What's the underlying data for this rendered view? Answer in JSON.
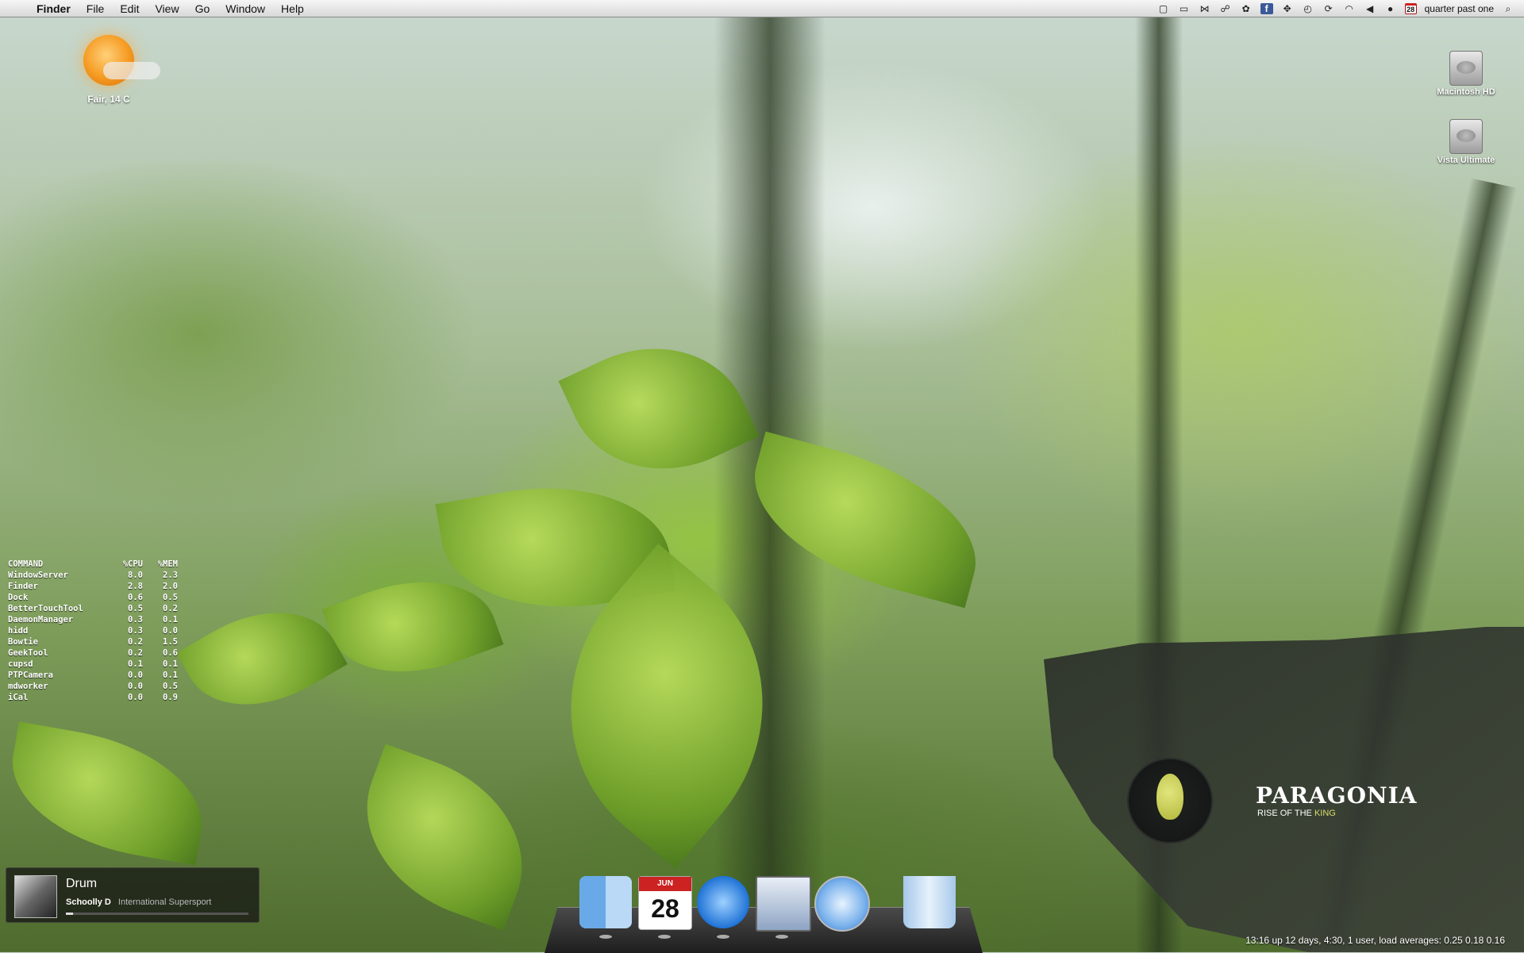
{
  "menubar": {
    "app_name": "Finder",
    "menus": [
      "File",
      "Edit",
      "View",
      "Go",
      "Window",
      "Help"
    ],
    "calendar_day": "28",
    "clock_text": "quarter past one"
  },
  "weather": {
    "text": "Fair, 14 C",
    "icon": "sun-icon"
  },
  "desktop_icons": [
    {
      "label": "Macintosh HD",
      "icon": "hard-drive-icon"
    },
    {
      "label": "Vista Ultimate",
      "icon": "hard-drive-icon"
    }
  ],
  "process_table": {
    "headers": [
      "COMMAND",
      "%CPU",
      "%MEM"
    ],
    "rows": [
      [
        "WindowServer",
        "8.0",
        "2.3"
      ],
      [
        "Finder",
        "2.8",
        "2.0"
      ],
      [
        "Dock",
        "0.6",
        "0.5"
      ],
      [
        "BetterTouchTool",
        "0.5",
        "0.2"
      ],
      [
        "DaemonManager",
        "0.3",
        "0.1"
      ],
      [
        "hidd",
        "0.3",
        "0.0"
      ],
      [
        "Bowtie",
        "0.2",
        "1.5"
      ],
      [
        "GeekTool",
        "0.2",
        "0.6"
      ],
      [
        "cupsd",
        "0.1",
        "0.1"
      ],
      [
        "PTPCamera",
        "0.0",
        "0.1"
      ],
      [
        "mdworker",
        "0.0",
        "0.5"
      ],
      [
        "iCal",
        "0.0",
        "0.9"
      ]
    ]
  },
  "now_playing": {
    "title": "Drum",
    "artist": "Schoolly D",
    "album": "International Supersport",
    "progress": 0.04
  },
  "wallpaper_brand": {
    "title": "PARAGONIA",
    "subtitle_prefix": "RISE OF THE",
    "subtitle_highlight": "KING"
  },
  "uptime": "13:16  up 12 days,  4:30, 1 user, load averages: 0.25 0.18 0.16",
  "dock": {
    "apps": [
      "Finder",
      "iCal",
      "iTunes",
      "Mail",
      "Safari",
      "Trash"
    ],
    "ical_month": "JUN",
    "ical_day": "28"
  }
}
